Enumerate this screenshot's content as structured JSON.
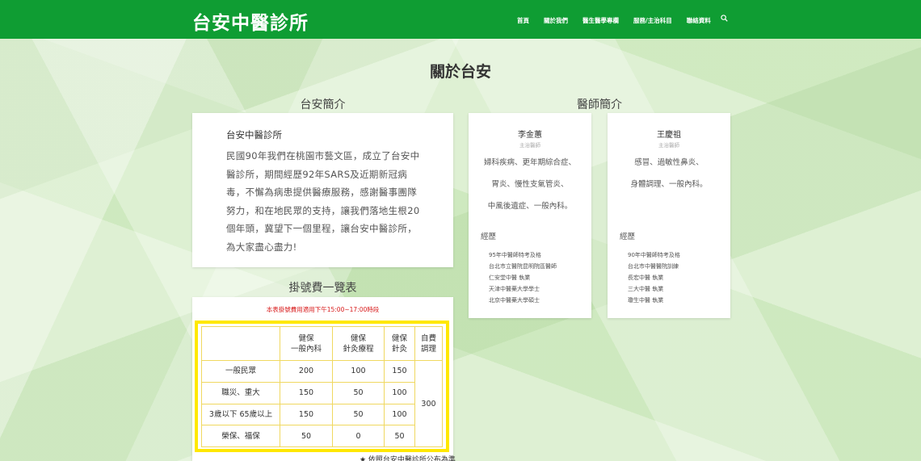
{
  "header": {
    "brand": "台安中醫診所",
    "nav": [
      "首頁",
      "關於我們",
      "醫生醫學專欄",
      "服務/主治科目",
      "聯絡資料"
    ]
  },
  "page_title": "關於台安",
  "intro": {
    "section_title": "台安簡介",
    "name": "台安中醫診所",
    "text": "民國90年我們在桃園市藝文區，成立了台安中醫診所，期間經歷92年SARS及近期新冠病毒，不懈為病患提供醫療服務，感謝醫事團隊努力，和在地民眾的支持，讓我們落地生根20個年頭，冀望下一個里程，讓台安中醫診所，為大家盡心盡力!"
  },
  "doctors": {
    "section_title": "醫師簡介",
    "exp_label": "經歷",
    "list": [
      {
        "name": "李金蕙",
        "title": "主治醫師",
        "specialties": [
          "婦科疾病、更年期綜合症、",
          "胃炎、慢性支氣管炎、",
          "中風後遺症、一般內科。"
        ],
        "experience": [
          "95年中醫師特考及格",
          "台北市立醫院昆明院區醫師",
          "仁安堂中醫 執業",
          "天津中醫藥大學學士",
          "北京中醫藥大學碩士"
        ]
      },
      {
        "name": "王慶祖",
        "title": "主治醫師",
        "specialties": [
          "感冒、過敏性鼻炎、",
          "身體調理、一般內科。"
        ],
        "experience": [
          "90年中醫師特考及格",
          "台北市中醫醫院訓練",
          "長宏中醫 執業",
          "三大中醫 執業",
          "瓊生中醫 執業"
        ]
      }
    ]
  },
  "fee": {
    "section_title": "掛號費一覽表",
    "note": "本表掛號費用適用下午15:00~17:00時段",
    "headers": [
      "",
      "健保\n一般內科",
      "健保\n針灸療程",
      "健保\n針灸",
      "自費\n調理"
    ],
    "rows": [
      {
        "label": "一般民眾",
        "values": [
          "200",
          "100",
          "150"
        ]
      },
      {
        "label": "職災、重大",
        "values": [
          "150",
          "50",
          "100"
        ]
      },
      {
        "label": "3歲以下 65歲以上",
        "values": [
          "150",
          "50",
          "100"
        ]
      },
      {
        "label": "榮保、福保",
        "values": [
          "50",
          "0",
          "50"
        ]
      }
    ],
    "self_pay": "300",
    "footnote": "★ 依照台安中醫診所公布為準"
  },
  "colors": {
    "header_bg": "#0f9d33",
    "note_red": "#d81b1b",
    "table_border": "#ffe800"
  }
}
